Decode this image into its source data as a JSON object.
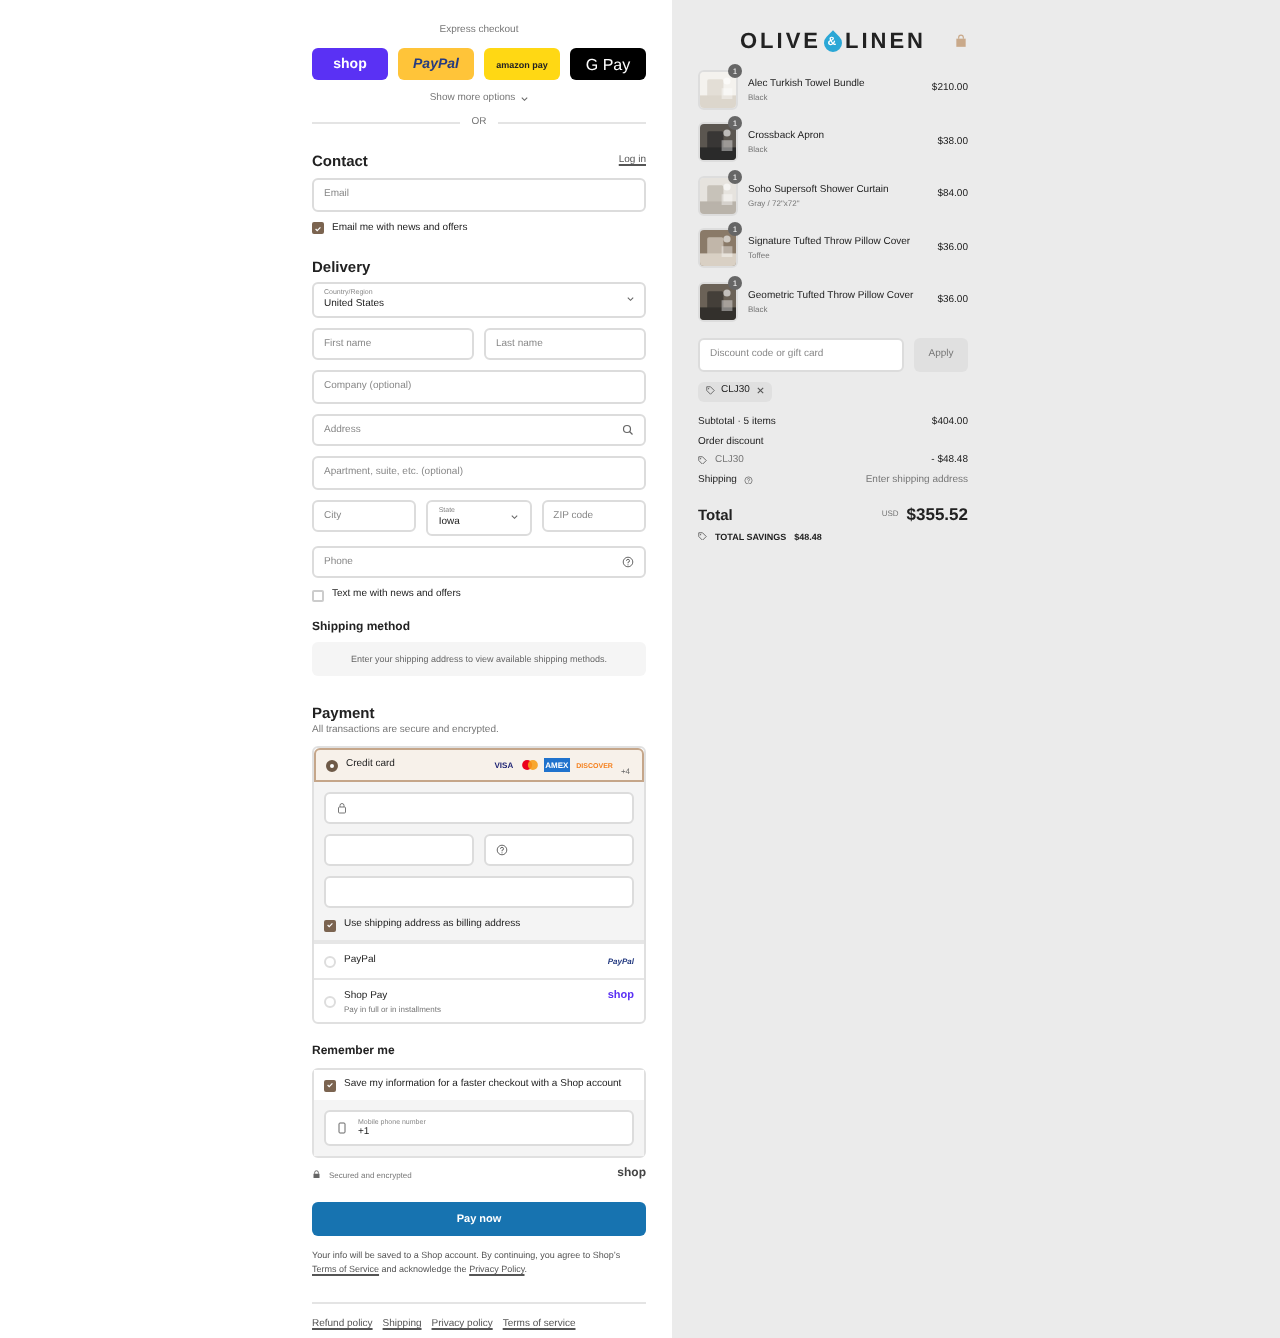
{
  "express_checkout": {
    "label": "Express checkout",
    "buttons": [
      {
        "kind": "shop",
        "label": "shop"
      },
      {
        "kind": "paypal",
        "label": "PayPal"
      },
      {
        "kind": "amazon",
        "label": "amazon pay"
      },
      {
        "kind": "gpay",
        "label": "G Pay"
      }
    ],
    "more": "Show more options",
    "divider": "OR"
  },
  "contact": {
    "title": "Contact",
    "login": "Log in",
    "email": {
      "placeholder": "Email"
    },
    "news": {
      "label": "Email me with news and offers",
      "checked": true
    }
  },
  "delivery": {
    "title": "Delivery",
    "country": {
      "label": "Country/Region",
      "value": "United States"
    },
    "fields": [
      {
        "kind": "pair",
        "items": [
          {
            "placeholder": "First name"
          },
          {
            "placeholder": "Last name"
          }
        ]
      },
      {
        "kind": "text",
        "placeholder": "Company (optional)"
      },
      {
        "kind": "search",
        "placeholder": "Address"
      },
      {
        "kind": "text",
        "placeholder": "Apartment, suite, etc. (optional)"
      },
      {
        "kind": "city",
        "items": [
          {
            "kind": "text",
            "placeholder": "City"
          },
          {
            "kind": "select",
            "label": "State",
            "value": "Iowa"
          },
          {
            "kind": "text",
            "placeholder": "ZIP code"
          }
        ]
      },
      {
        "kind": "help",
        "placeholder": "Phone"
      }
    ],
    "sms": {
      "label": "Text me with news and offers",
      "checked": false
    }
  },
  "shipping_method": {
    "title": "Shipping method",
    "notice": "Enter your shipping address to view available shipping methods."
  },
  "payment": {
    "title": "Payment",
    "subtitle": "All transactions are secure and encrypted.",
    "methods": [
      {
        "kind": "card",
        "label": "Credit card",
        "selected": true,
        "brands": [
          {
            "kind": "visa",
            "label": "VISA"
          },
          {
            "kind": "mastercard"
          },
          {
            "kind": "amex",
            "label": "AMEX"
          },
          {
            "kind": "discover",
            "label": "DISCOVER"
          },
          {
            "kind": "more",
            "label": "+4"
          }
        ],
        "billing": {
          "label": "Use shipping address as billing address",
          "checked": true
        }
      },
      {
        "kind": "paypal",
        "label": "PayPal",
        "selected": false,
        "logo": "PayPal"
      },
      {
        "kind": "shoppay",
        "label": "Shop Pay",
        "sublabel": "Pay in full or in installments",
        "selected": false,
        "logo": "shop"
      }
    ]
  },
  "remember": {
    "title": "Remember me",
    "save": {
      "label": "Save my information for a faster checkout with a Shop account",
      "checked": true
    },
    "mobile": {
      "label": "Mobile phone number",
      "value": "+1"
    },
    "secure": "Secured and encrypted",
    "logo": "shop"
  },
  "pay_button": "Pay now",
  "legal": [
    {
      "kind": "text",
      "text": "Your info will be saved to a Shop account. By continuing, you agree to Shop’s "
    },
    {
      "kind": "link",
      "text": "Terms of Service"
    },
    {
      "kind": "text",
      "text": " and acknowledge the "
    },
    {
      "kind": "link",
      "text": "Privacy Policy"
    },
    {
      "kind": "text",
      "text": "."
    }
  ],
  "footer_links": [
    "Refund policy",
    "Shipping",
    "Privacy policy",
    "Terms of service"
  ],
  "summary": {
    "logo": {
      "left": "OLIVE",
      "mark": "&",
      "right": "LINEN"
    },
    "items": [
      {
        "name": "Alec Turkish Towel Bundle",
        "variant": "Black",
        "price": "$210.00",
        "quantity": "1"
      },
      {
        "name": "Crossback Apron",
        "variant": "Black",
        "price": "$38.00",
        "quantity": "1"
      },
      {
        "name": "Soho Supersoft Shower Curtain",
        "variant": "Gray / 72\"x72\"",
        "price": "$84.00",
        "quantity": "1"
      },
      {
        "name": "Signature Tufted Throw Pillow Cover",
        "variant": "Toffee",
        "price": "$36.00",
        "quantity": "1"
      },
      {
        "name": "Geometric Tufted Throw Pillow Cover",
        "variant": "Black",
        "price": "$36.00",
        "quantity": "1"
      }
    ],
    "discount": {
      "placeholder": "Discount code or gift card",
      "button": "Apply",
      "tag": "CLJ30"
    },
    "subtotal": {
      "label": "Subtotal · 5 items",
      "value": "$404.00"
    },
    "order_discount": {
      "label": "Order discount",
      "code": "CLJ30",
      "value": "- $48.48"
    },
    "shipping": {
      "label": "Shipping",
      "value": "Enter shipping address"
    },
    "total": {
      "label": "Total",
      "currency": "USD",
      "value": "$355.52"
    },
    "savings": {
      "label": "TOTAL SAVINGS",
      "value": "$48.48"
    }
  }
}
